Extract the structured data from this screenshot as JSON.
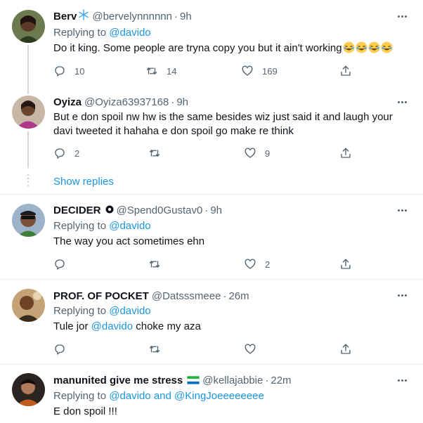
{
  "tweets": [
    {
      "name": "Berv",
      "name_emoji": "❄️",
      "handle": "@bervelynnnnnn",
      "sep": "·",
      "time": "9h",
      "replying_label": "Replying to",
      "replying_mentions": [
        "@davido"
      ],
      "replying_joiner": "",
      "text": "Do it king. Some people are tryna copy you but it ain't working",
      "trailing_emoji": "😂😂😂😂",
      "reply_count": "10",
      "retweet_count": "14",
      "like_count": "169"
    },
    {
      "name": "Oyiza",
      "handle": "@Oyiza63937168",
      "sep": "·",
      "time": "9h",
      "text": "But e don spoil nw hw is the same besides wiz just said it and laugh your davi tweeted it hahaha e don spoil go make re think",
      "reply_count": "2",
      "retweet_count": "",
      "like_count": "9",
      "show_replies": "Show replies"
    },
    {
      "name": "DECIDER",
      "handle": "@Spend0Gustav0",
      "sep": "·",
      "time": "9h",
      "replying_label": "Replying to",
      "replying_mentions": [
        "@davido"
      ],
      "text": "The way you act sometimes ehn",
      "reply_count": "",
      "retweet_count": "",
      "like_count": "2"
    },
    {
      "name": "PROF. OF POCKET",
      "handle": "@Datsssmeee",
      "sep": "·",
      "time": "26m",
      "replying_label": "Replying to",
      "replying_mentions": [
        "@davido"
      ],
      "text_pre": "Tule jor ",
      "text_mention": "@davido",
      "text_post": " choke my aza",
      "reply_count": "",
      "retweet_count": "",
      "like_count": ""
    },
    {
      "name": "manunited give me stress",
      "handle": "@kellajabbie",
      "sep": "·",
      "time": "22m",
      "replying_label": "Replying to",
      "replying_mentions": [
        "@davido",
        "@KingJoeeeeeeee"
      ],
      "replying_joiner": "and",
      "text": "E don spoil !!!"
    }
  ],
  "colors": {
    "accent": "#1b95e0",
    "muted": "#536471",
    "divider": "#e6ecf0",
    "flag_green": "#1eb53a",
    "flag_blue": "#0072c6"
  }
}
